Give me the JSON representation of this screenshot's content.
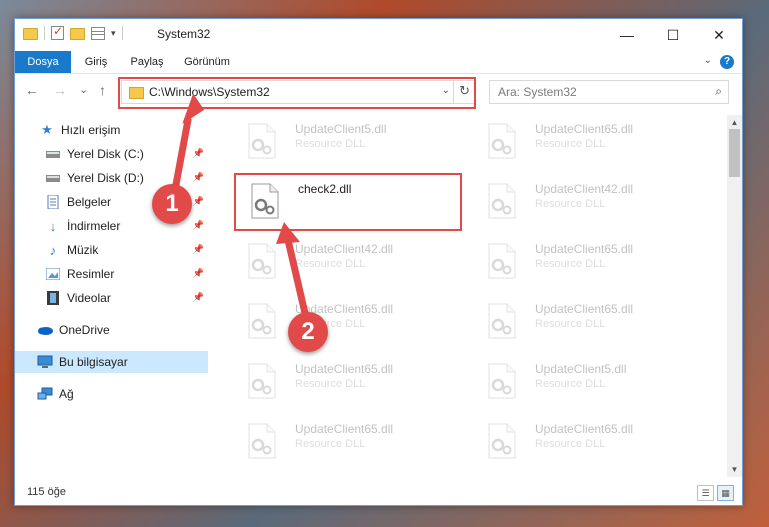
{
  "window": {
    "title": "System32",
    "controls": {
      "minimize": "—",
      "maximize": "☐",
      "close": "✕"
    }
  },
  "ribbon": {
    "tabs": [
      "Dosya",
      "Giriş",
      "Paylaş",
      "Görünüm"
    ]
  },
  "nav": {
    "back": "←",
    "forward": "→",
    "recent": "⌄",
    "up": "↑",
    "address": "C:\\Windows\\System32",
    "search_placeholder": "Ara: System32"
  },
  "sidebar": {
    "items": [
      {
        "label": "Hızlı erişim",
        "icon": "star-icon"
      },
      {
        "label": "Yerel Disk (C:)",
        "icon": "drive-icon",
        "pinned": true
      },
      {
        "label": "Yerel Disk (D:)",
        "icon": "drive-icon",
        "pinned": true
      },
      {
        "label": "Belgeler",
        "icon": "documents-icon",
        "pinned": true
      },
      {
        "label": "İndirmeler",
        "icon": "download-icon",
        "pinned": true
      },
      {
        "label": "Müzik",
        "icon": "music-icon",
        "pinned": true
      },
      {
        "label": "Resimler",
        "icon": "pictures-icon",
        "pinned": true
      },
      {
        "label": "Videolar",
        "icon": "video-icon",
        "pinned": true
      },
      {
        "label": "OneDrive",
        "icon": "cloud-icon"
      },
      {
        "label": "Bu bilgisayar",
        "icon": "computer-icon",
        "selected": true
      },
      {
        "label": "Ağ",
        "icon": "network-icon"
      }
    ]
  },
  "files": {
    "left": [
      {
        "name": "UpdateClient5.dll",
        "desc": "Resource DLL"
      },
      {
        "name": "check2.dll",
        "desc": ""
      },
      {
        "name": "UpdateClient42.dll",
        "desc": "Resource DLL"
      },
      {
        "name": "UpdateClient65.dll",
        "desc": "Resource DLL"
      },
      {
        "name": "UpdateClient65.dll",
        "desc": "Resource DLL"
      },
      {
        "name": "UpdateClient65.dll",
        "desc": "Resource DLL"
      }
    ],
    "right": [
      {
        "name": "UpdateClient65.dll",
        "desc": "Resource DLL"
      },
      {
        "name": "UpdateClient42.dll",
        "desc": "Resource DLL"
      },
      {
        "name": "UpdateClient65.dll",
        "desc": "Resource DLL"
      },
      {
        "name": "UpdateClient65.dll",
        "desc": "Resource DLL"
      },
      {
        "name": "UpdateClient5.dll",
        "desc": "Resource DLL"
      },
      {
        "name": "UpdateClient65.dll",
        "desc": "Resource DLL"
      }
    ]
  },
  "status": {
    "count": "115 öğe"
  },
  "annotations": {
    "step1": "1",
    "step2": "2",
    "color": "#e24a4a"
  }
}
